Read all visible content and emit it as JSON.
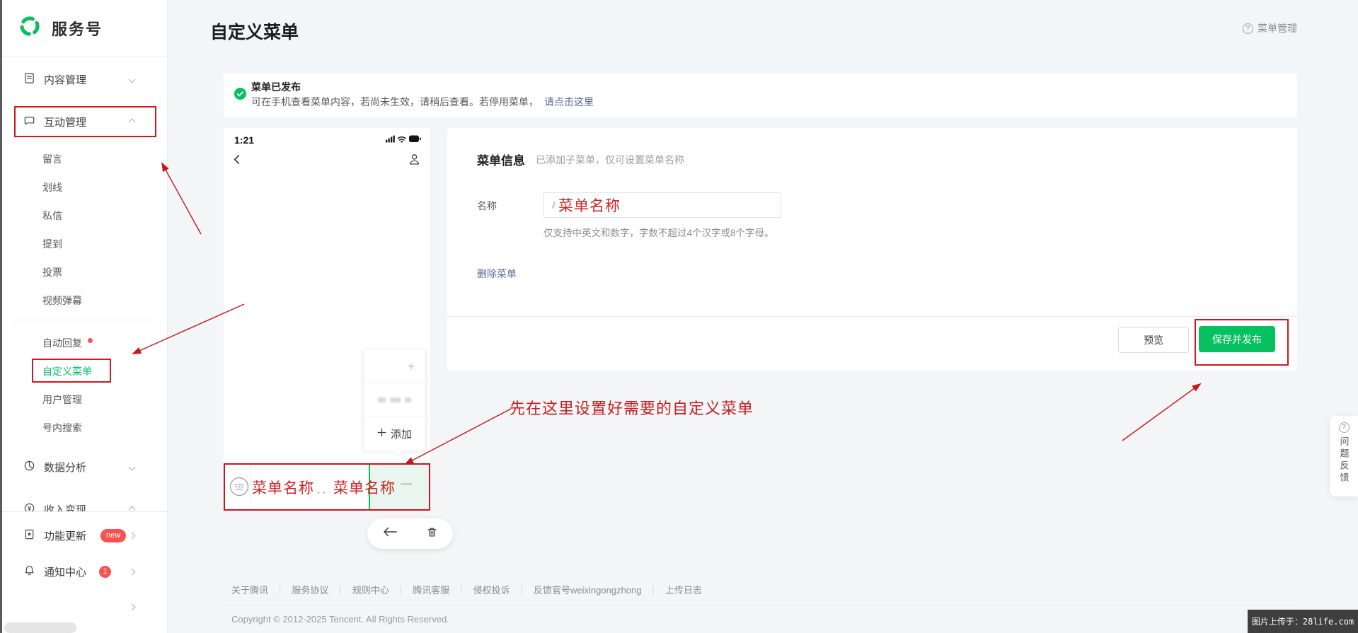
{
  "colors": {
    "brand_green": "#07c160",
    "annotation_red": "#d0191d",
    "link_blue": "#576b95",
    "badge_red": "#fa5151",
    "page_bg": "#f4f5f7"
  },
  "sidebar": {
    "logo_label": "服务号",
    "groups": {
      "content": "内容管理",
      "interaction": "互动管理",
      "data": "数据分析",
      "income": "收入变现",
      "feature": "功能更新",
      "feature_badge": "new",
      "notice": "通知中心",
      "notice_badge": "1"
    },
    "interaction_children": [
      "留言",
      "划线",
      "私信",
      "提到",
      "投票",
      "视频弹幕"
    ],
    "tools_children": [
      "自动回复",
      "自定义菜单",
      "用户管理",
      "号内搜索"
    ]
  },
  "header": {
    "title": "自定义菜单",
    "help_label": "菜单管理"
  },
  "banner": {
    "title": "菜单已发布",
    "body": "可在手机查看菜单内容，若尚未生效，请稍后查看。若停用菜单，",
    "link_label": "请点击这里"
  },
  "phone": {
    "status_time": "1:21",
    "menu_slot_1": "菜单名称",
    "menu_slot_2": "菜单名称",
    "popup_add_label": "添加"
  },
  "form": {
    "section_title": "菜单信息",
    "section_subtitle": "已添加子菜单，仅可设置菜单名称",
    "name_label": "名称",
    "name_value": "菜单名称",
    "name_helper": "仅支持中英文和数字，字数不超过4个汉字或8个字母。",
    "delete_label": "删除菜单",
    "preview_label": "预览",
    "save_label": "保存并发布"
  },
  "annotation": {
    "tip_text": "先在这里设置好需要的自定义菜单"
  },
  "icons": {
    "question": "?"
  },
  "feedback": {
    "label": "问题反馈"
  },
  "footer": {
    "links": [
      "关于腾讯",
      "服务协议",
      "规则中心",
      "腾讯客服",
      "侵权投诉",
      "反馈官号weixingongzhong",
      "上传日志"
    ],
    "separator": "|",
    "copyright": "Copyright © 2012-2025 Tencent. All Rights Reserved."
  },
  "watermark": {
    "text": "图片上传于：28life.com"
  }
}
